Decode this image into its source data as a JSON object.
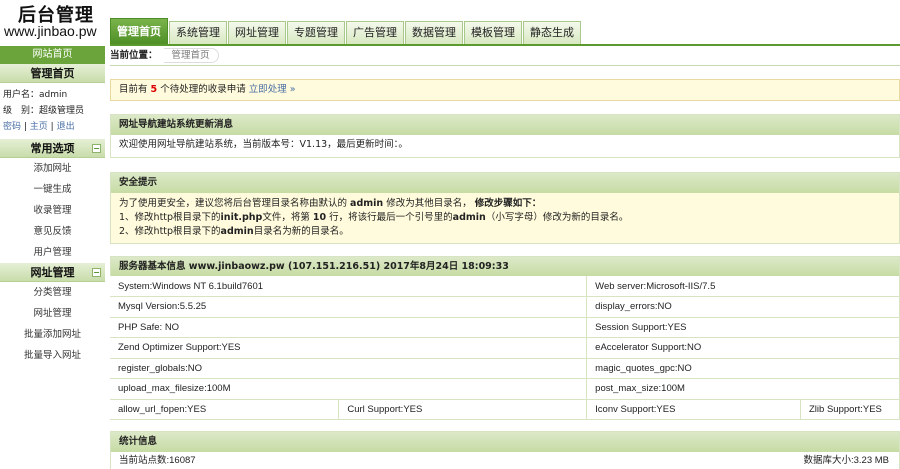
{
  "header": {
    "logo_title": "后台管理",
    "logo_url": "www.jinbao.pw",
    "tabs": [
      {
        "label": "管理首页",
        "active": true
      },
      {
        "label": "系统管理"
      },
      {
        "label": "网址管理"
      },
      {
        "label": "专题管理"
      },
      {
        "label": "广告管理"
      },
      {
        "label": "数据管理"
      },
      {
        "label": "模板管理"
      },
      {
        "label": "静态生成"
      }
    ]
  },
  "sidebar": {
    "site_home": "网站首页",
    "section_home": "管理首页",
    "user_line1": "用户名：admin",
    "user_line2": "级　别：超级管理员",
    "user_links": [
      "密码",
      "主页",
      "退出"
    ],
    "section_common": "常用选项",
    "common_items": [
      "添加网址",
      "一键生成",
      "收录管理",
      "意见反馈",
      "用户管理"
    ],
    "section_url": "网址管理",
    "url_items": [
      "分类管理",
      "网址管理",
      "批量添加网址",
      "批量导入网址"
    ],
    "collapse_symbol": "−"
  },
  "breadcrumb": {
    "label": "当前位置：",
    "current": "管理首页"
  },
  "pending": {
    "prefix": "目前有",
    "count": "5",
    "suffix": "个待处理的收录申请",
    "action": "立即处理 »"
  },
  "update_box": {
    "title": "网址导航建站系统更新消息",
    "text": "欢迎使用网址导航建站系统，当前版本号：V1.13，最后更新时间：。"
  },
  "security_box": {
    "title": "安全提示",
    "line1_a": "为了使用更安全，建议您将后台管理目录名称由默认的",
    "line1_b": "admin",
    "line1_c": "修改为其他目录名，",
    "line1_d": "修改步骤如下：",
    "line2_a": "1、修改http根目录下的",
    "line2_b": "init.php",
    "line2_c": "文件，将第",
    "line2_d": "10",
    "line2_e": "行，将该行最后一个引号里的",
    "line2_f": "admin",
    "line2_g": "（小写字母）修改为新的目录名。",
    "line3_a": "2、修改http根目录下的",
    "line3_b": "admin",
    "line3_c": "目录名为新的目录名。"
  },
  "server_box": {
    "title": "服务器基本信息 www.jinbaowz.pw (107.151.216.51) 2017年8月24日 18:09:33",
    "rows": [
      [
        "System:Windows NT 6.1build7601",
        "Web server:Microsoft-IIS/7.5"
      ],
      [
        "Mysql Version:5.5.25",
        "display_errors:NO"
      ],
      [
        "PHP Safe: NO",
        "Session Support:YES"
      ],
      [
        "Zend Optimizer Support:YES",
        "eAccelerator Support:NO"
      ],
      [
        "register_globals:NO",
        "magic_quotes_gpc:NO"
      ],
      [
        "upload_max_filesize:100M",
        "post_max_size:100M"
      ]
    ],
    "last_row": [
      "allow_url_fopen:YES",
      "Curl Support:YES",
      "Iconv Support:YES",
      "Zlib Support:YES"
    ]
  },
  "stats_box": {
    "title": "统计信息",
    "sites": "当前站点数:16087",
    "db_size": "数据库大小:3.23 MB"
  }
}
